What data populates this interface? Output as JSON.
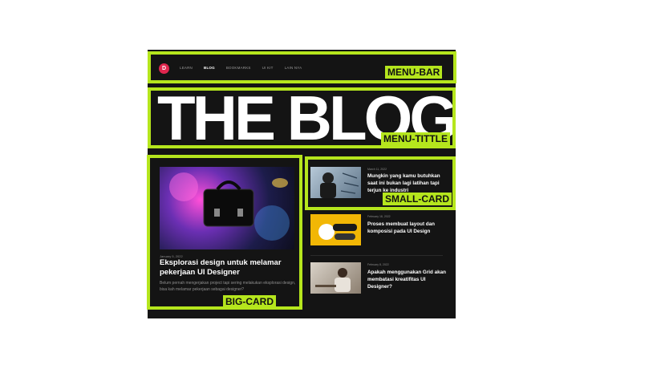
{
  "nav": {
    "logo_letter": "D",
    "items": [
      "LEARN",
      "BLOG",
      "BOOKMARKS",
      "UI KIT",
      "LAIN NYA"
    ],
    "active": "BLOG"
  },
  "hero": {
    "title": "THE BLOG"
  },
  "big_card": {
    "date": "January 5, 2022",
    "title": "Eksplorasi design untuk melamar pekerjaan UI Designer",
    "description": "Belum pernah mengerjakan project tapi sering melakukan eksplorasi design, bisa kah melamar pekerjaan sebagai designer?"
  },
  "small_cards": [
    {
      "date": "March 11, 2022",
      "title": "Mungkin yang kamu butuhkan saat ini bukan lagi latihan tapi terjun ke industri"
    },
    {
      "date": "February 18, 2022",
      "title": "Proses membuat layout dan komposisi pada UI Design"
    },
    {
      "date": "February 8, 2022",
      "title": "Apakah menggunakan Grid akan membatasi kreatifitas UI Designer?"
    }
  ],
  "annotations": {
    "menu_bar": "MENU-BAR",
    "menu_title": "MENU-TITTLE",
    "big_card": "BIG-CARD",
    "small_card": "SMALL-CARD"
  },
  "colors": {
    "highlight": "#b5e61d",
    "background": "#141414",
    "logo": "#e0264e"
  }
}
